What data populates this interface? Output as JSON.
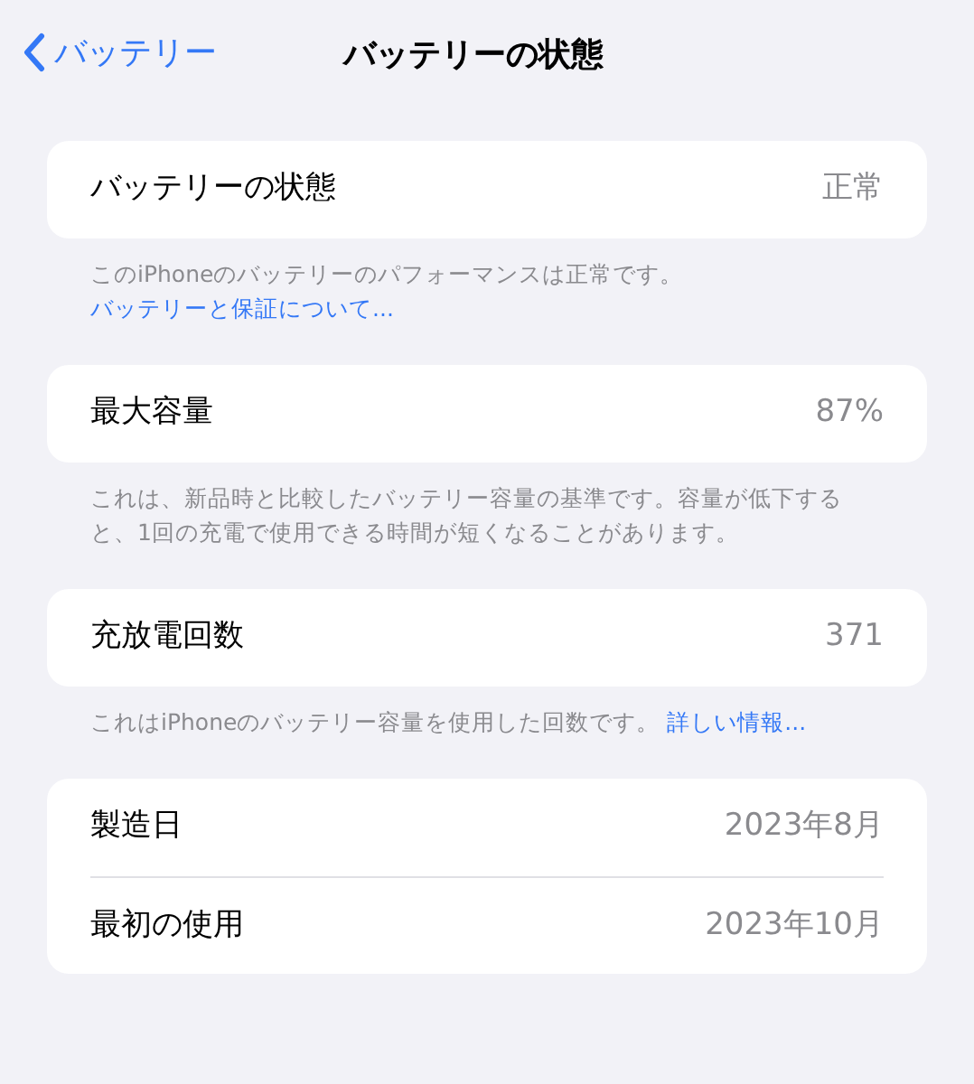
{
  "nav": {
    "back_label": "バッテリー",
    "title": "バッテリーの状態"
  },
  "sections": [
    {
      "rows": [
        {
          "label": "バッテリーの状態",
          "value": "正常"
        }
      ],
      "footer": {
        "text": "このiPhoneのバッテリーのパフォーマンスは正常です。",
        "link": "バッテリーと保証について..."
      }
    },
    {
      "rows": [
        {
          "label": "最大容量",
          "value": "87%"
        }
      ],
      "footer": {
        "text": "これは、新品時と比較したバッテリー容量の基準です。容量が低下すると、1回の充電で使用できる時間が短くなることがあります。"
      }
    },
    {
      "rows": [
        {
          "label": "充放電回数",
          "value": "371"
        }
      ],
      "footer": {
        "text": "これはiPhoneのバッテリー容量を使用した回数です。 ",
        "link": "詳しい情報..."
      }
    },
    {
      "rows": [
        {
          "label": "製造日",
          "value": "2023年8月"
        },
        {
          "label": "最初の使用",
          "value": "2023年10月"
        }
      ]
    }
  ]
}
